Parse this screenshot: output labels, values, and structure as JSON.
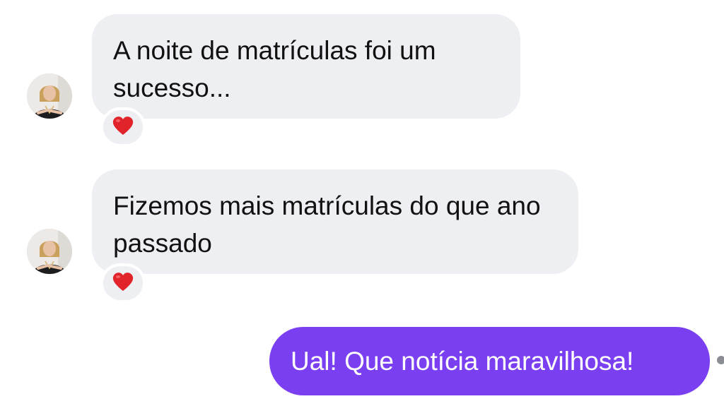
{
  "messages": [
    {
      "direction": "incoming",
      "text": "A noite de matrículas foi um sucesso...",
      "reaction": "heart-icon"
    },
    {
      "direction": "incoming",
      "text": "Fizemos mais matrículas do que ano passado",
      "reaction": "heart-icon"
    },
    {
      "direction": "outgoing",
      "text": "Ual! Que notícia maravilhosa!"
    }
  ],
  "colors": {
    "incoming_bubble": "#eeeff3",
    "outgoing_bubble": "#7b3ff2",
    "reaction_heart": "#e0242a",
    "text_dark": "#111111",
    "text_light": "#ffffff"
  }
}
